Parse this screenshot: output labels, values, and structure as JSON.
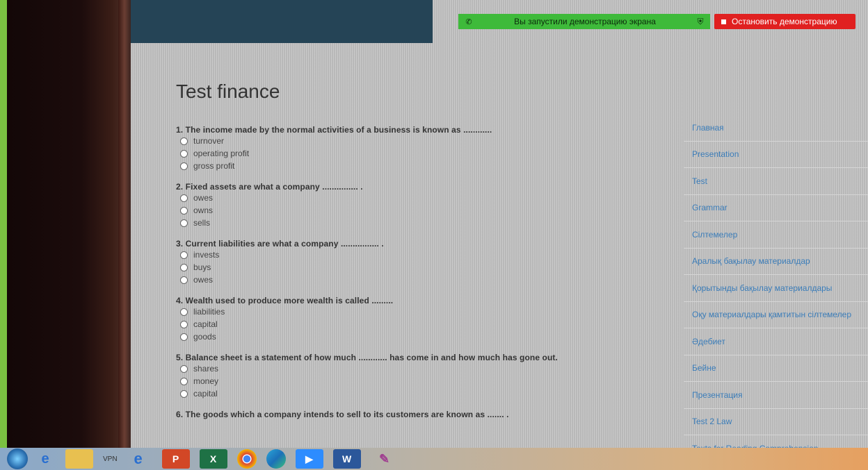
{
  "share": {
    "message": "Вы запустили демонстрацию экрана",
    "stop_label": "Остановить демонстрацию"
  },
  "page": {
    "title": "Test finance"
  },
  "questions": [
    {
      "text": "1. The income made by the normal activities of a business is known as ............",
      "options": [
        "turnover",
        "operating profit",
        "gross profit"
      ]
    },
    {
      "text": "2. Fixed assets are what a company ............... .",
      "options": [
        "owes",
        "owns",
        "sells"
      ]
    },
    {
      "text": "3. Current liabilities are what a company ................ .",
      "options": [
        "invests",
        "buys",
        "owes"
      ]
    },
    {
      "text": "4. Wealth used to produce more wealth is called .........",
      "options": [
        "liabilities",
        "capital",
        "goods"
      ]
    },
    {
      "text": "5. Balance sheet is a statement of how much ............ has come in and how much has gone out.",
      "options": [
        "shares",
        "money",
        "capital"
      ]
    },
    {
      "text": "6. The goods which a company intends to sell to its customers are known as ....... .",
      "options": []
    }
  ],
  "nav": {
    "items": [
      "Главная",
      "Presentation",
      "Test",
      "Grammar",
      "Сілтемелер",
      "Аралық бақылау материалдар",
      "Қорытынды бақылау материалдары",
      "Оқу материалдары қамтитын сілтемелер",
      "Әдебиет",
      "Бейне",
      "Презентация",
      "Test 2 Law",
      "Texts for Reading Comprehension"
    ]
  },
  "taskbar": {
    "vpn_label": "VPN",
    "icons": [
      "start-orb",
      "ie-icon",
      "explorer",
      "edge-legacy",
      "powerpoint",
      "excel",
      "chrome",
      "edge",
      "zoom",
      "word",
      "paint"
    ]
  },
  "colors": {
    "header": "#254456",
    "share_green": "#3eba3a",
    "stop_red": "#e02020",
    "link": "#3a7cb8"
  }
}
